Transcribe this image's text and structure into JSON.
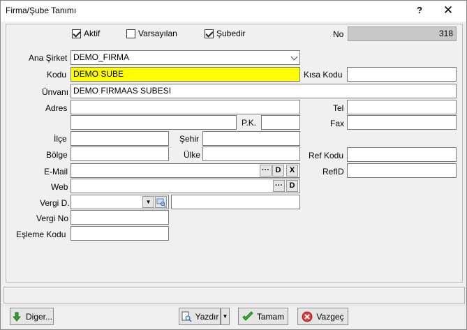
{
  "window": {
    "title": "Firma/Şube Tanımı",
    "help": "?",
    "close": "✕"
  },
  "checkboxes": [
    {
      "label": "Aktif",
      "checked": true
    },
    {
      "label": "Varsayılan",
      "checked": false
    },
    {
      "label": "Şubedir",
      "checked": true
    }
  ],
  "no": {
    "label": "No",
    "value": "318"
  },
  "ana_sirket": {
    "label": "Ana Şirket",
    "value": "DEMO_FIRMA"
  },
  "kodu": {
    "label": "Kodu",
    "value": "DEMO SUBE"
  },
  "kisa_kodu": {
    "label": "Kısa Kodu",
    "value": ""
  },
  "unvani": {
    "label": "Ünvanı",
    "value": "DEMO FIRMAAS SUBESI"
  },
  "adres": {
    "label": "Adres",
    "line1": "",
    "line2": ""
  },
  "pk": {
    "label": "P.K.",
    "value": ""
  },
  "tel": {
    "label": "Tel",
    "value": ""
  },
  "fax": {
    "label": "Fax",
    "value": ""
  },
  "ilce": {
    "label": "İlçe",
    "value": ""
  },
  "sehir": {
    "label": "Şehir",
    "value": ""
  },
  "bolge": {
    "label": "Bölge",
    "value": ""
  },
  "ulke": {
    "label": "Ülke",
    "value": ""
  },
  "ref_kodu": {
    "label": "Ref Kodu",
    "value": ""
  },
  "email": {
    "label": "E-Mail",
    "value": "",
    "btn_more": "···",
    "btn_d": "D",
    "btn_x": "X"
  },
  "refid": {
    "label": "RefID",
    "value": ""
  },
  "web": {
    "label": "Web",
    "value": "",
    "btn_more": "···",
    "btn_d": "D"
  },
  "vergi_d": {
    "label": "Vergi D.",
    "value": "",
    "name": ""
  },
  "vergi_no": {
    "label": "Vergi No",
    "value": ""
  },
  "esleme_kodu": {
    "label": "Eşleme Kodu",
    "value": ""
  },
  "buttons": {
    "diger": "Diger...",
    "yazdir": "Yazdır",
    "tamam": "Tamam",
    "vazgec": "Vazgeç"
  }
}
